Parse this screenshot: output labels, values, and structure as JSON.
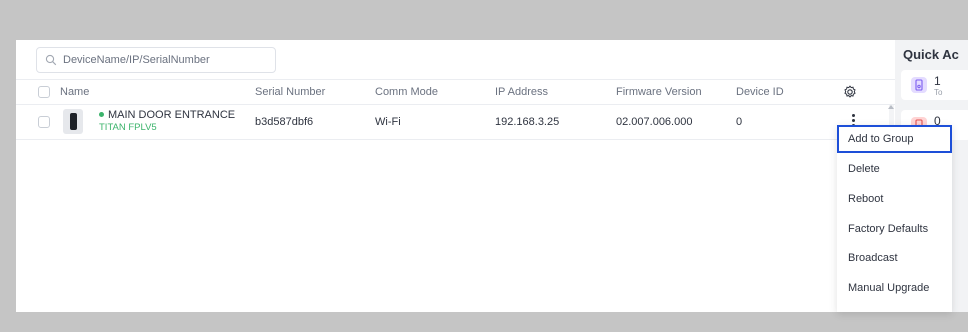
{
  "search": {
    "placeholder": "DeviceName/IP/SerialNumber"
  },
  "table": {
    "columns": [
      "Name",
      "Serial Number",
      "Comm Mode",
      "IP Address",
      "Firmware Version",
      "Device ID"
    ],
    "rows": [
      {
        "name": "MAIN DOOR ENTRANCE",
        "model": "TITAN FPLV5",
        "serial": "b3d587dbf6",
        "comm_mode": "Wi-Fi",
        "ip": "192.168.3.25",
        "firmware": "02.007.006.000",
        "device_id": "0",
        "status": "online"
      }
    ]
  },
  "quick": {
    "title": "Quick Ac",
    "cards": [
      {
        "count": "1",
        "label": "To",
        "color": "#ddd6fe",
        "icon": "device-icon"
      },
      {
        "count": "0",
        "label": "",
        "color": "#fecaca",
        "icon": "device-offline-icon"
      }
    ]
  },
  "menu": {
    "items": [
      "Add to Group",
      "Delete",
      "Reboot",
      "Factory Defaults",
      "Broadcast",
      "Manual Upgrade"
    ],
    "focused_index": 0
  },
  "colors": {
    "accent": "#1d4fd8",
    "online": "#3bb36b",
    "backdrop": "#c5c5c5"
  }
}
